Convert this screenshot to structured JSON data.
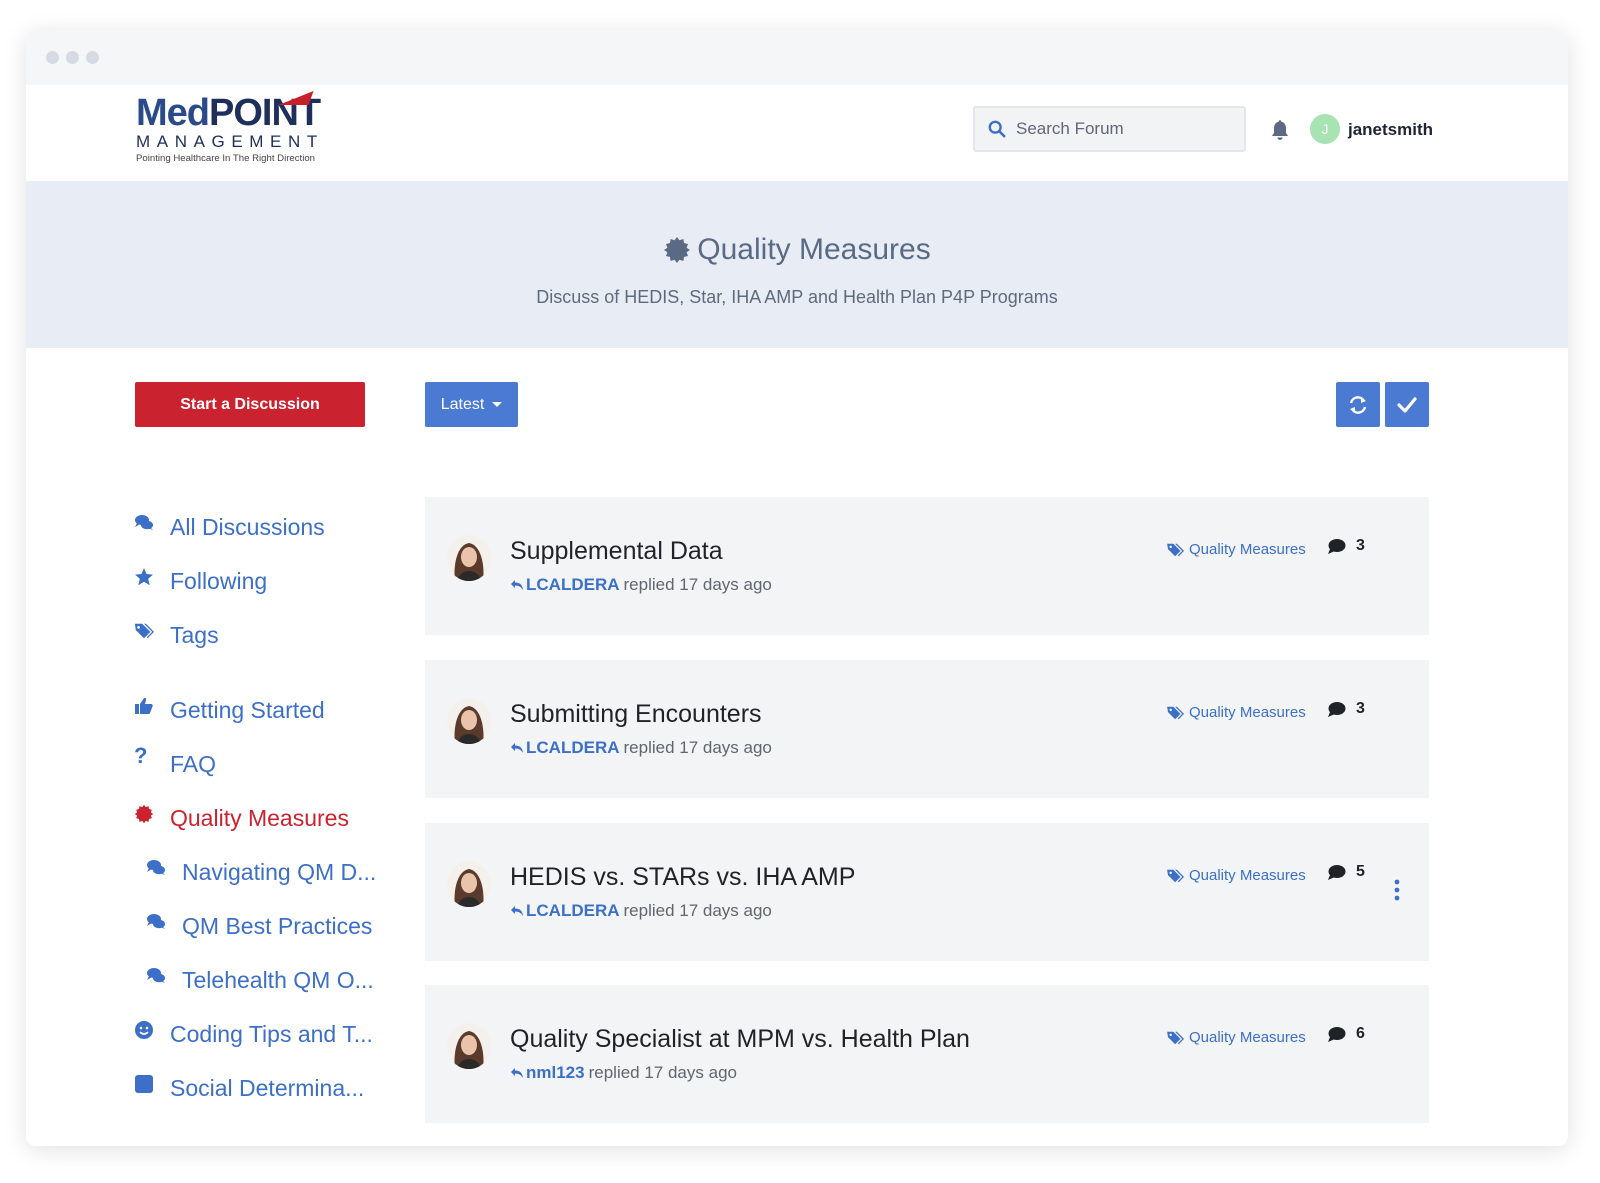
{
  "app": {
    "logo_text_med": "Med",
    "logo_text_point": "POINT",
    "logo_line2": "MANAGEMENT",
    "logo_tagline": "Pointing Healthcare In The Right Direction"
  },
  "header": {
    "search_placeholder": "Search Forum",
    "avatar_letter": "J",
    "username": "janetsmith"
  },
  "hero": {
    "title": "Quality Measures",
    "description": "Discuss of HEDIS, Star, IHA AMP and Health Plan P4P Programs"
  },
  "toolbar": {
    "start_label": "Start a Discussion",
    "sort_label": "Latest"
  },
  "sidebar": {
    "items": [
      {
        "label": "All Discussions",
        "icon": "comments-icon"
      },
      {
        "label": "Following",
        "icon": "star-icon"
      },
      {
        "label": "Tags",
        "icon": "tags-icon"
      },
      {
        "label": "Getting Started",
        "icon": "thumbs-up-icon"
      },
      {
        "label": "FAQ",
        "icon": "question-icon"
      },
      {
        "label": "Quality Measures",
        "icon": "badge-icon"
      },
      {
        "label": "Navigating QM D...",
        "icon": "comments-icon"
      },
      {
        "label": "QM Best Practices",
        "icon": "comments-icon"
      },
      {
        "label": "Telehealth QM O...",
        "icon": "comments-icon"
      },
      {
        "label": "Coding Tips and T...",
        "icon": "smile-icon"
      },
      {
        "label": "Social Determina...",
        "icon": "square-icon"
      }
    ]
  },
  "discussions": [
    {
      "title": "Supplemental Data",
      "user": "LCALDERA",
      "action": "replied 17 days ago",
      "tag": "Quality Measures",
      "count": "3"
    },
    {
      "title": "Submitting Encounters",
      "user": "LCALDERA",
      "action": "replied 17 days ago",
      "tag": "Quality Measures",
      "count": "3"
    },
    {
      "title": "HEDIS vs. STARs vs. IHA AMP",
      "user": "LCALDERA",
      "action": "replied 17 days ago",
      "tag": "Quality Measures",
      "count": "5"
    },
    {
      "title": "Quality Specialist at MPM vs. Health Plan",
      "user": "nml123",
      "action": "replied 17 days ago",
      "tag": "Quality Measures",
      "count": "6"
    }
  ],
  "colors": {
    "brand_red": "#cb2230",
    "brand_blue": "#4a7ad2",
    "link_blue": "#3c6fc7",
    "hero_bg": "#e8edf5"
  }
}
